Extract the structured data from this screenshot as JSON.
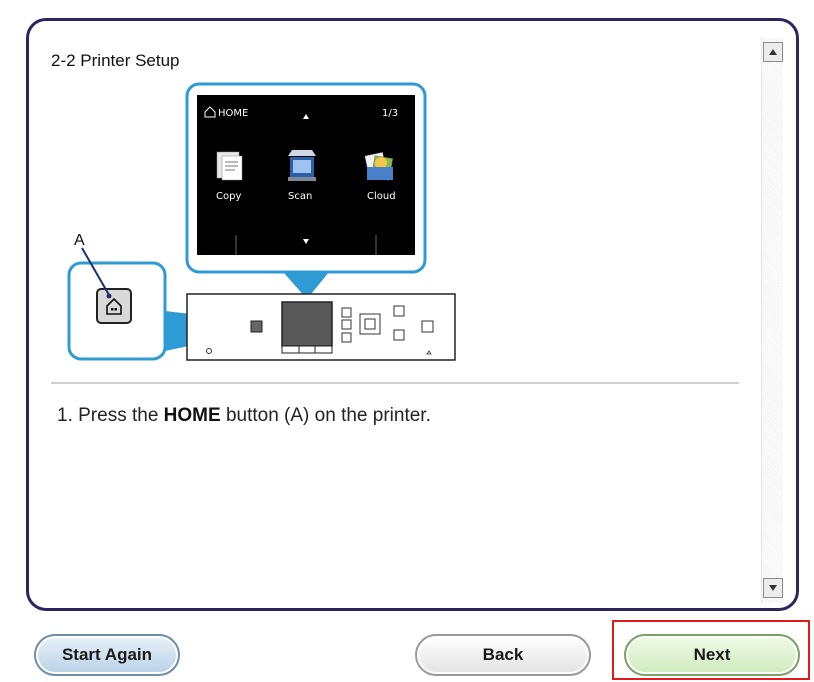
{
  "page": {
    "section_title": "2-2 Printer Setup",
    "instruction_prefix": "1. Press the ",
    "instruction_bold": "HOME",
    "instruction_suffix": " button (A) on the printer."
  },
  "illustration": {
    "callout_letter": "A",
    "screen": {
      "home_label": "HOME",
      "page_indicator": "1/3",
      "icons": [
        {
          "label": "Copy",
          "icon": "copy-icon"
        },
        {
          "label": "Scan",
          "icon": "scan-icon"
        },
        {
          "label": "Cloud",
          "icon": "cloud-icon"
        }
      ]
    }
  },
  "buttons": {
    "start_again": "Start Again",
    "back": "Back",
    "next": "Next"
  },
  "colors": {
    "panel_border": "#2b2560",
    "callout_blue": "#2f9bd4",
    "highlight_red": "#e11b1b"
  }
}
